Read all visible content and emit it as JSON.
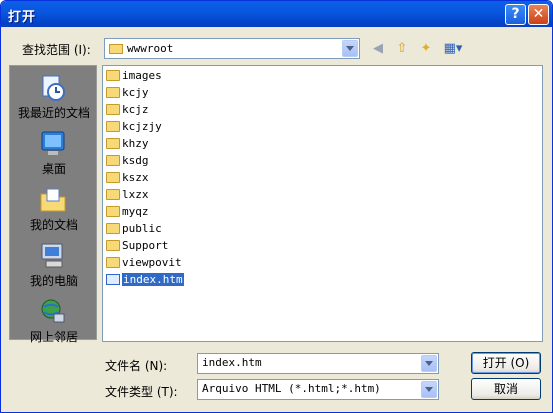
{
  "title": "打开",
  "title_buttons": {
    "help": "?",
    "close": "✕"
  },
  "lookin": {
    "label": "查找范围 (I):",
    "value": "wwwroot"
  },
  "places": [
    {
      "label": "我最近的文档",
      "icon": "recent-documents-icon"
    },
    {
      "label": "桌面",
      "icon": "desktop-icon"
    },
    {
      "label": "我的文档",
      "icon": "my-documents-icon"
    },
    {
      "label": "我的电脑",
      "icon": "my-computer-icon"
    },
    {
      "label": "网上邻居",
      "icon": "network-places-icon"
    }
  ],
  "files": [
    {
      "name": "images",
      "type": "folder"
    },
    {
      "name": "kcjy",
      "type": "folder"
    },
    {
      "name": "kcjz",
      "type": "folder"
    },
    {
      "name": "kcjzjy",
      "type": "folder"
    },
    {
      "name": "khzy",
      "type": "folder"
    },
    {
      "name": "ksdg",
      "type": "folder"
    },
    {
      "name": "kszx",
      "type": "folder"
    },
    {
      "name": "lxzx",
      "type": "folder"
    },
    {
      "name": "myqz",
      "type": "folder"
    },
    {
      "name": "public",
      "type": "folder"
    },
    {
      "name": "Support",
      "type": "folder"
    },
    {
      "name": "viewpovit",
      "type": "folder"
    },
    {
      "name": "index.htm",
      "type": "file",
      "selected": true
    }
  ],
  "filename": {
    "label": "文件名 (N):",
    "value": "index.htm"
  },
  "filetype": {
    "label": "文件类型 (T):",
    "value": "Arquivo HTML (*.html;*.htm)"
  },
  "buttons": {
    "open": "打开 (O)",
    "cancel": "取消"
  }
}
